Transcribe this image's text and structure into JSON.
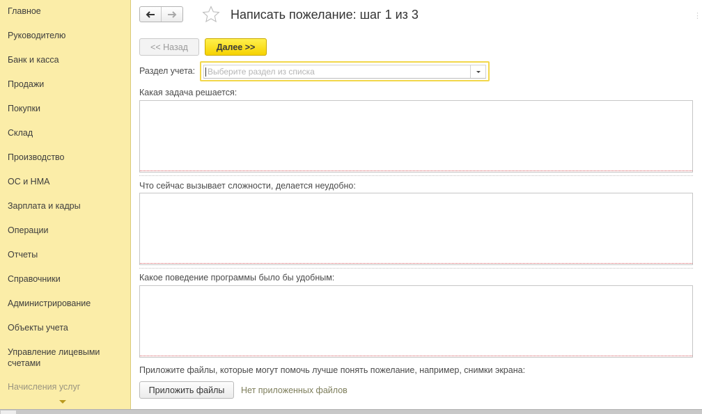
{
  "sidebar": {
    "items": [
      {
        "label": "Главное"
      },
      {
        "label": "Руководителю"
      },
      {
        "label": "Банк и касса"
      },
      {
        "label": "Продажи"
      },
      {
        "label": "Покупки"
      },
      {
        "label": "Склад"
      },
      {
        "label": "Производство"
      },
      {
        "label": "ОС и НМА"
      },
      {
        "label": "Зарплата и кадры"
      },
      {
        "label": "Операции"
      },
      {
        "label": "Отчеты"
      },
      {
        "label": "Справочники"
      },
      {
        "label": "Администрирование"
      },
      {
        "label": "Объекты учета"
      },
      {
        "label": "Управление лицевыми\nсчетами"
      },
      {
        "label": "Начисления услуг"
      }
    ],
    "more_icon": "chevron-down-icon"
  },
  "header": {
    "title": "Написать пожелание: шаг 1 из 3",
    "back_icon": "arrow-left-icon",
    "forward_icon": "arrow-right-icon",
    "favorite_icon": "star-icon"
  },
  "toolbar": {
    "back_label": "<< Назад",
    "next_label": "Далее >>"
  },
  "form": {
    "section_label": "Раздел учета:",
    "section_placeholder": "Выберите раздел из списка",
    "section_value": "",
    "task_label": "Какая задача решается:",
    "difficulty_label": "Что сейчас вызывает сложности, делается неудобно:",
    "desired_label": "Какое поведение программы было бы удобным:",
    "attach_hint": "Приложите файлы, которые могут помочь лучше понять пожелание, например, снимки экрана:",
    "attach_button": "Приложить файлы",
    "no_files": "Нет приложенных файлов"
  },
  "colors": {
    "sidebar_bg": "#fbeda8",
    "accent_yellow": "#f6d200",
    "required_underline": "#d8595f"
  }
}
